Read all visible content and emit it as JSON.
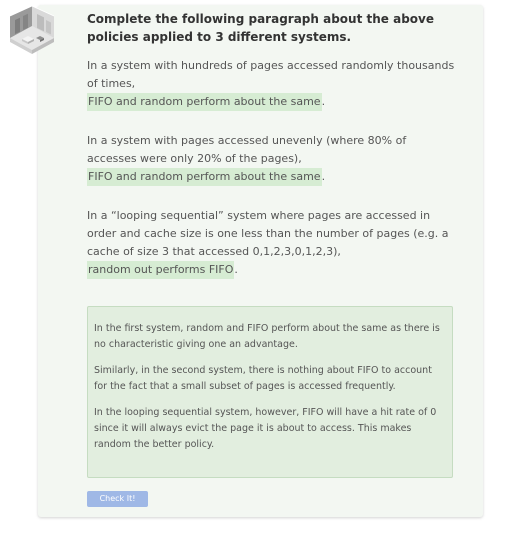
{
  "exercise": {
    "title": "Complete the following paragraph about the above policies applied to 3 different systems.",
    "paragraphs": [
      {
        "prompt": "In a system with hundreds of pages accessed randomly thousands of times,",
        "answer": "FIFO and random perform about the same",
        "suffix": "."
      },
      {
        "prompt": "In a system with pages accessed unevenly (where 80% of accesses were only 20% of the pages),",
        "answer": "FIFO and random perform about the same",
        "suffix": "."
      },
      {
        "prompt": "In a “looping sequential” system where pages are accessed in order and cache size is one less than the number of pages (e.g. a cache of size 3 that accessed 0,1,2,3,0,1,2,3),",
        "answer": "random out performs FIFO",
        "suffix": "."
      }
    ],
    "explanation": [
      "In the first system, random and FIFO perform about the same as there is no characteristic giving one an advantage.",
      "Similarly, in the second system, there is nothing about FIFO to account for the fact that a small subset of pages is accessed frequently.",
      "In the looping sequential system, however, FIFO will have a hit rate of 0 since it will always evict the page it is about to access. This makes random the better policy."
    ],
    "check_label": "Check It!"
  },
  "colors": {
    "card_bg": "#f3f7f2",
    "answer_highlight": "#d6ecd3",
    "explanation_bg": "#e2eedf",
    "button_bg": "#9fb8e6"
  },
  "icons": {
    "avatar": "isometric-room-icon"
  }
}
